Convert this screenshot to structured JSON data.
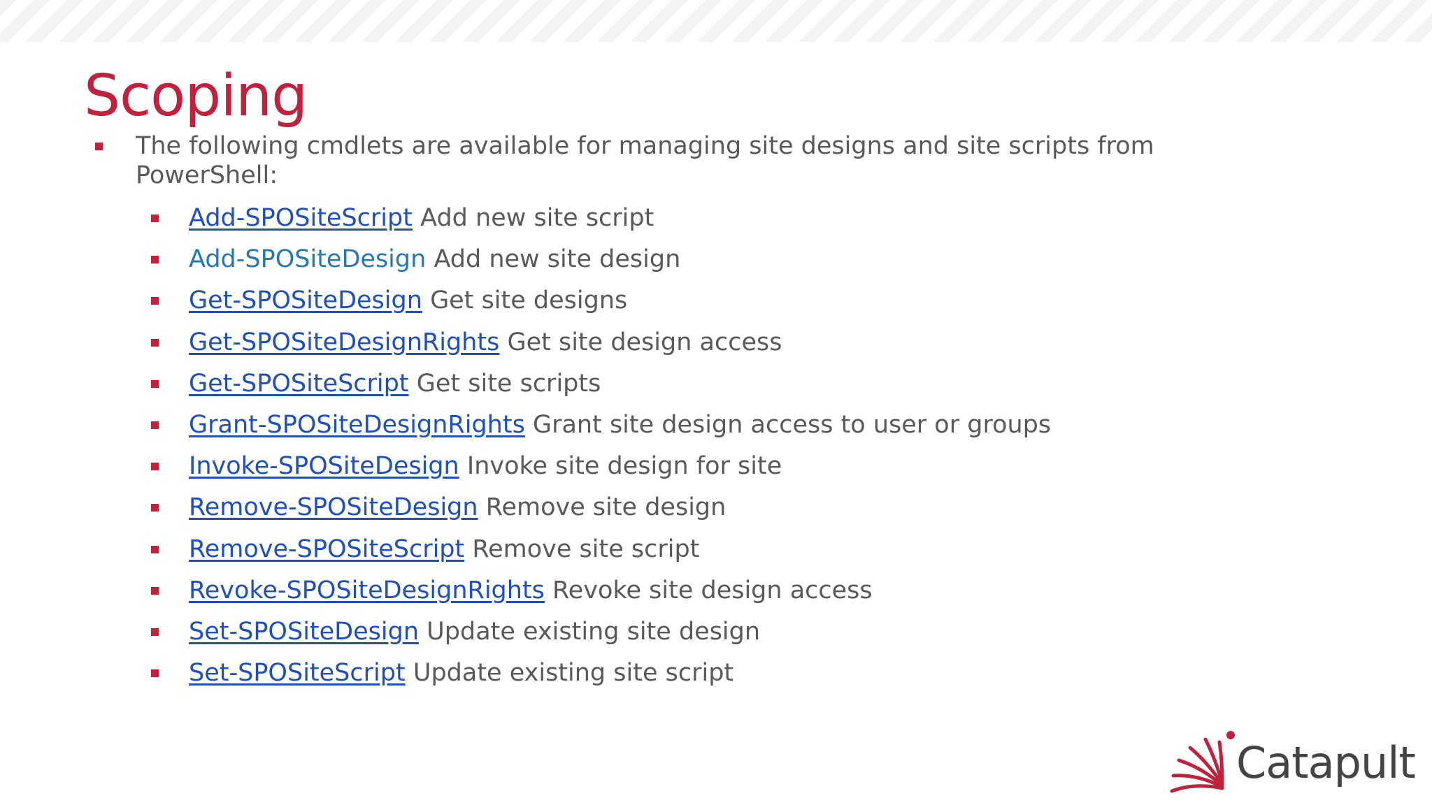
{
  "slide": {
    "title": "Scoping",
    "intro": "The following cmdlets are available for managing site designs and site scripts from PowerShell:",
    "items": [
      {
        "cmd": "Add-SPOSiteScript",
        "desc": "Add new site script",
        "linked": true
      },
      {
        "cmd": "Add-SPOSiteDesign",
        "desc": "Add new site design",
        "linked": false
      },
      {
        "cmd": "Get-SPOSiteDesign",
        "desc": "Get site designs",
        "linked": true
      },
      {
        "cmd": "Get-SPOSiteDesignRights",
        "desc": "Get site design access",
        "linked": true
      },
      {
        "cmd": "Get-SPOSiteScript",
        "desc": "Get site scripts",
        "linked": true
      },
      {
        "cmd": "Grant-SPOSiteDesignRights",
        "desc": "Grant site design access to user or groups",
        "linked": true
      },
      {
        "cmd": "Invoke-SPOSiteDesign",
        "desc": "Invoke site design for site",
        "linked": true
      },
      {
        "cmd": "Remove-SPOSiteDesign",
        "desc": "Remove site design",
        "linked": true
      },
      {
        "cmd": "Remove-SPOSiteScript",
        "desc": "Remove site script",
        "linked": true
      },
      {
        "cmd": "Revoke-SPOSiteDesignRights",
        "desc": "Revoke site design access",
        "linked": true
      },
      {
        "cmd": "Set-SPOSiteDesign",
        "desc": "Update existing site design",
        "linked": true
      },
      {
        "cmd": "Set-SPOSiteScript",
        "desc": "Update existing site script",
        "linked": true
      }
    ]
  },
  "logo": {
    "text": "Catapult",
    "icon": "catapult-logo-icon"
  },
  "colors": {
    "title": "#c0213c",
    "bullet": "#c0213c",
    "link": "#1f4fbf",
    "plain_cmd": "#2378b5",
    "body_text": "#595959",
    "logo_text": "#444444",
    "logo_mark": "#c0213c"
  }
}
